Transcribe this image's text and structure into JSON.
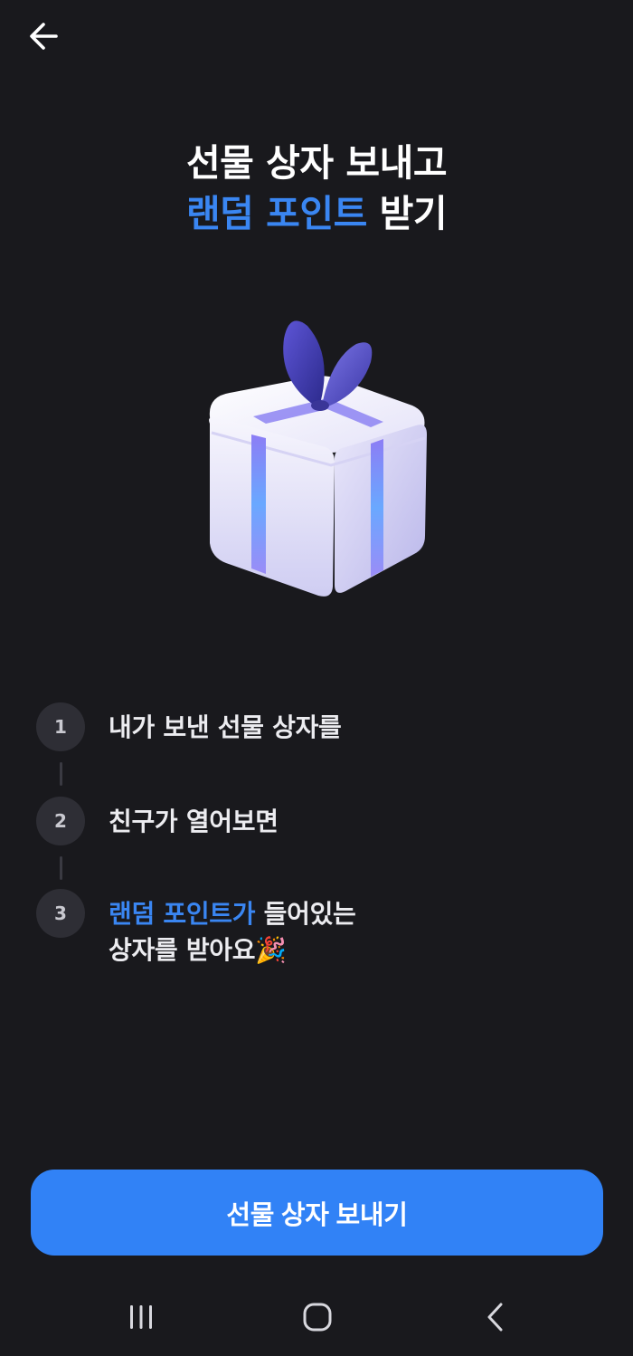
{
  "header": {
    "back_icon": "arrow-left-icon"
  },
  "headline": {
    "line1": "선물 상자 보내고",
    "line2_accent": "랜덤 포인트",
    "line2_rest": " 받기"
  },
  "illustration": {
    "icon": "gift-box-icon"
  },
  "steps": [
    {
      "number": "1",
      "text": "내가 보낸 선물 상자를"
    },
    {
      "number": "2",
      "text": "친구가 열어보면"
    },
    {
      "number": "3",
      "accent": "랜덤 포인트가",
      "text_after": " 들어있는",
      "line2": "상자를 받아요",
      "emoji": "🎉"
    }
  ],
  "cta": {
    "label": "선물 상자 보내기"
  },
  "system_nav": {
    "recent_icon": "recent-apps-icon",
    "home_icon": "home-icon",
    "back_icon": "nav-back-icon"
  },
  "colors": {
    "background": "#19191d",
    "accent": "#3182f6",
    "step_circle": "#2e2e35"
  }
}
